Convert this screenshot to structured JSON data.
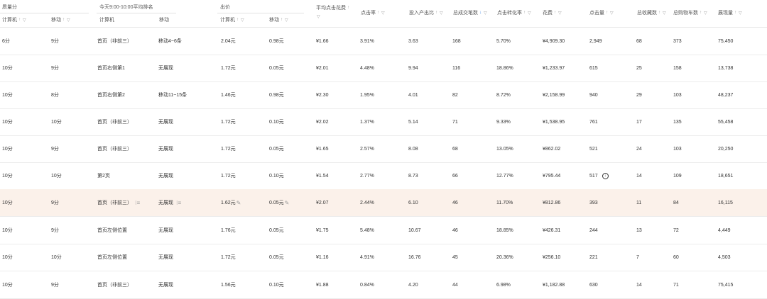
{
  "groups": {
    "quality": "质量分",
    "rank": "今天9:00-10:00平均排名",
    "bid": "出价"
  },
  "columns": {
    "q_pc": "计算机",
    "q_mobile": "移动",
    "r_pc": "计算机",
    "r_mobile": "移动",
    "b_pc": "计算机",
    "b_mobile": "移动",
    "avg_cpc": "平均点击花费",
    "ctr": "点击率",
    "roi": "投入产出比",
    "deals": "总成交笔数",
    "cvr": "点击转化率",
    "cost": "花费",
    "clicks": "点击量",
    "favs": "总收藏数",
    "carts": "总购物车数",
    "impressions": "展现量"
  },
  "icons": {
    "sort": "sort-icon",
    "filter": "filter-icon",
    "sort_desc": "sort-descending-icon",
    "sort_up": "sort-up-icon",
    "rank_list": "rank-list-icon",
    "edit": "pencil-icon",
    "info": "info-icon"
  },
  "colors": {
    "highlight_row": "#fbf1ea",
    "active_sort": "#2f7de1"
  },
  "rows": [
    {
      "q_pc": "6分",
      "q_mobile": "9分",
      "r_pc": "首页（非前三）",
      "r_mobile": "移动4~6条",
      "b_pc": "2.04元",
      "b_mobile": "0.98元",
      "avg_cpc": "¥1.66",
      "ctr": "3.91%",
      "roi": "3.63",
      "deals": "168",
      "cvr": "5.70%",
      "cost": "¥4,909.30",
      "clicks": "2,949",
      "favs": "68",
      "carts": "373",
      "impressions": "75,450"
    },
    {
      "q_pc": "10分",
      "q_mobile": "9分",
      "r_pc": "首页右侧第1",
      "r_mobile": "无展现",
      "b_pc": "1.72元",
      "b_mobile": "0.05元",
      "avg_cpc": "¥2.01",
      "ctr": "4.48%",
      "roi": "9.94",
      "deals": "116",
      "cvr": "18.86%",
      "cost": "¥1,233.97",
      "clicks": "615",
      "favs": "25",
      "carts": "158",
      "impressions": "13,738"
    },
    {
      "q_pc": "10分",
      "q_mobile": "8分",
      "r_pc": "首页右侧第2",
      "r_mobile": "移动11~15条",
      "b_pc": "1.46元",
      "b_mobile": "0.98元",
      "avg_cpc": "¥2.30",
      "ctr": "1.95%",
      "roi": "4.01",
      "deals": "82",
      "cvr": "8.72%",
      "cost": "¥2,158.99",
      "clicks": "940",
      "favs": "29",
      "carts": "103",
      "impressions": "48,237"
    },
    {
      "q_pc": "10分",
      "q_mobile": "10分",
      "r_pc": "首页（非前三）",
      "r_mobile": "无展现",
      "b_pc": "1.72元",
      "b_mobile": "0.10元",
      "avg_cpc": "¥2.02",
      "ctr": "1.37%",
      "roi": "5.14",
      "deals": "71",
      "cvr": "9.33%",
      "cost": "¥1,538.95",
      "clicks": "761",
      "favs": "17",
      "carts": "135",
      "impressions": "55,458"
    },
    {
      "q_pc": "10分",
      "q_mobile": "9分",
      "r_pc": "首页（非前三）",
      "r_mobile": "无展现",
      "b_pc": "1.72元",
      "b_mobile": "0.05元",
      "avg_cpc": "¥1.65",
      "ctr": "2.57%",
      "roi": "8.08",
      "deals": "68",
      "cvr": "13.05%",
      "cost": "¥862.02",
      "clicks": "521",
      "favs": "24",
      "carts": "103",
      "impressions": "20,250"
    },
    {
      "q_pc": "10分",
      "q_mobile": "10分",
      "r_pc": "第2页",
      "r_mobile": "无展现",
      "b_pc": "1.72元",
      "b_mobile": "0.10元",
      "avg_cpc": "¥1.54",
      "ctr": "2.77%",
      "roi": "8.73",
      "deals": "66",
      "cvr": "12.77%",
      "cost": "¥795.44",
      "clicks": "517",
      "favs": "14",
      "carts": "109",
      "impressions": "18,651"
    },
    {
      "q_pc": "10分",
      "q_mobile": "9分",
      "r_pc": "首页（非前三）",
      "r_mobile": "无展现",
      "b_pc": "1.62元",
      "b_mobile": "0.05元",
      "avg_cpc": "¥2.07",
      "ctr": "2.44%",
      "roi": "6.10",
      "deals": "46",
      "cvr": "11.70%",
      "cost": "¥812.86",
      "clicks": "393",
      "favs": "11",
      "carts": "84",
      "impressions": "16,115"
    },
    {
      "q_pc": "10分",
      "q_mobile": "9分",
      "r_pc": "首页左侧位置",
      "r_mobile": "无展现",
      "b_pc": "1.76元",
      "b_mobile": "0.05元",
      "avg_cpc": "¥1.75",
      "ctr": "5.48%",
      "roi": "10.67",
      "deals": "46",
      "cvr": "18.85%",
      "cost": "¥426.31",
      "clicks": "244",
      "favs": "13",
      "carts": "72",
      "impressions": "4,449"
    },
    {
      "q_pc": "10分",
      "q_mobile": "10分",
      "r_pc": "首页左侧位置",
      "r_mobile": "无展现",
      "b_pc": "1.72元",
      "b_mobile": "0.05元",
      "avg_cpc": "¥1.16",
      "ctr": "4.91%",
      "roi": "16.76",
      "deals": "45",
      "cvr": "20.36%",
      "cost": "¥256.10",
      "clicks": "221",
      "favs": "7",
      "carts": "60",
      "impressions": "4,503"
    },
    {
      "q_pc": "10分",
      "q_mobile": "9分",
      "r_pc": "首页（非前三）",
      "r_mobile": "无展现",
      "b_pc": "1.56元",
      "b_mobile": "0.10元",
      "avg_cpc": "¥1.88",
      "ctr": "0.84%",
      "roi": "4.20",
      "deals": "44",
      "cvr": "6.98%",
      "cost": "¥1,182.88",
      "clicks": "630",
      "favs": "14",
      "carts": "71",
      "impressions": "75,415"
    }
  ]
}
